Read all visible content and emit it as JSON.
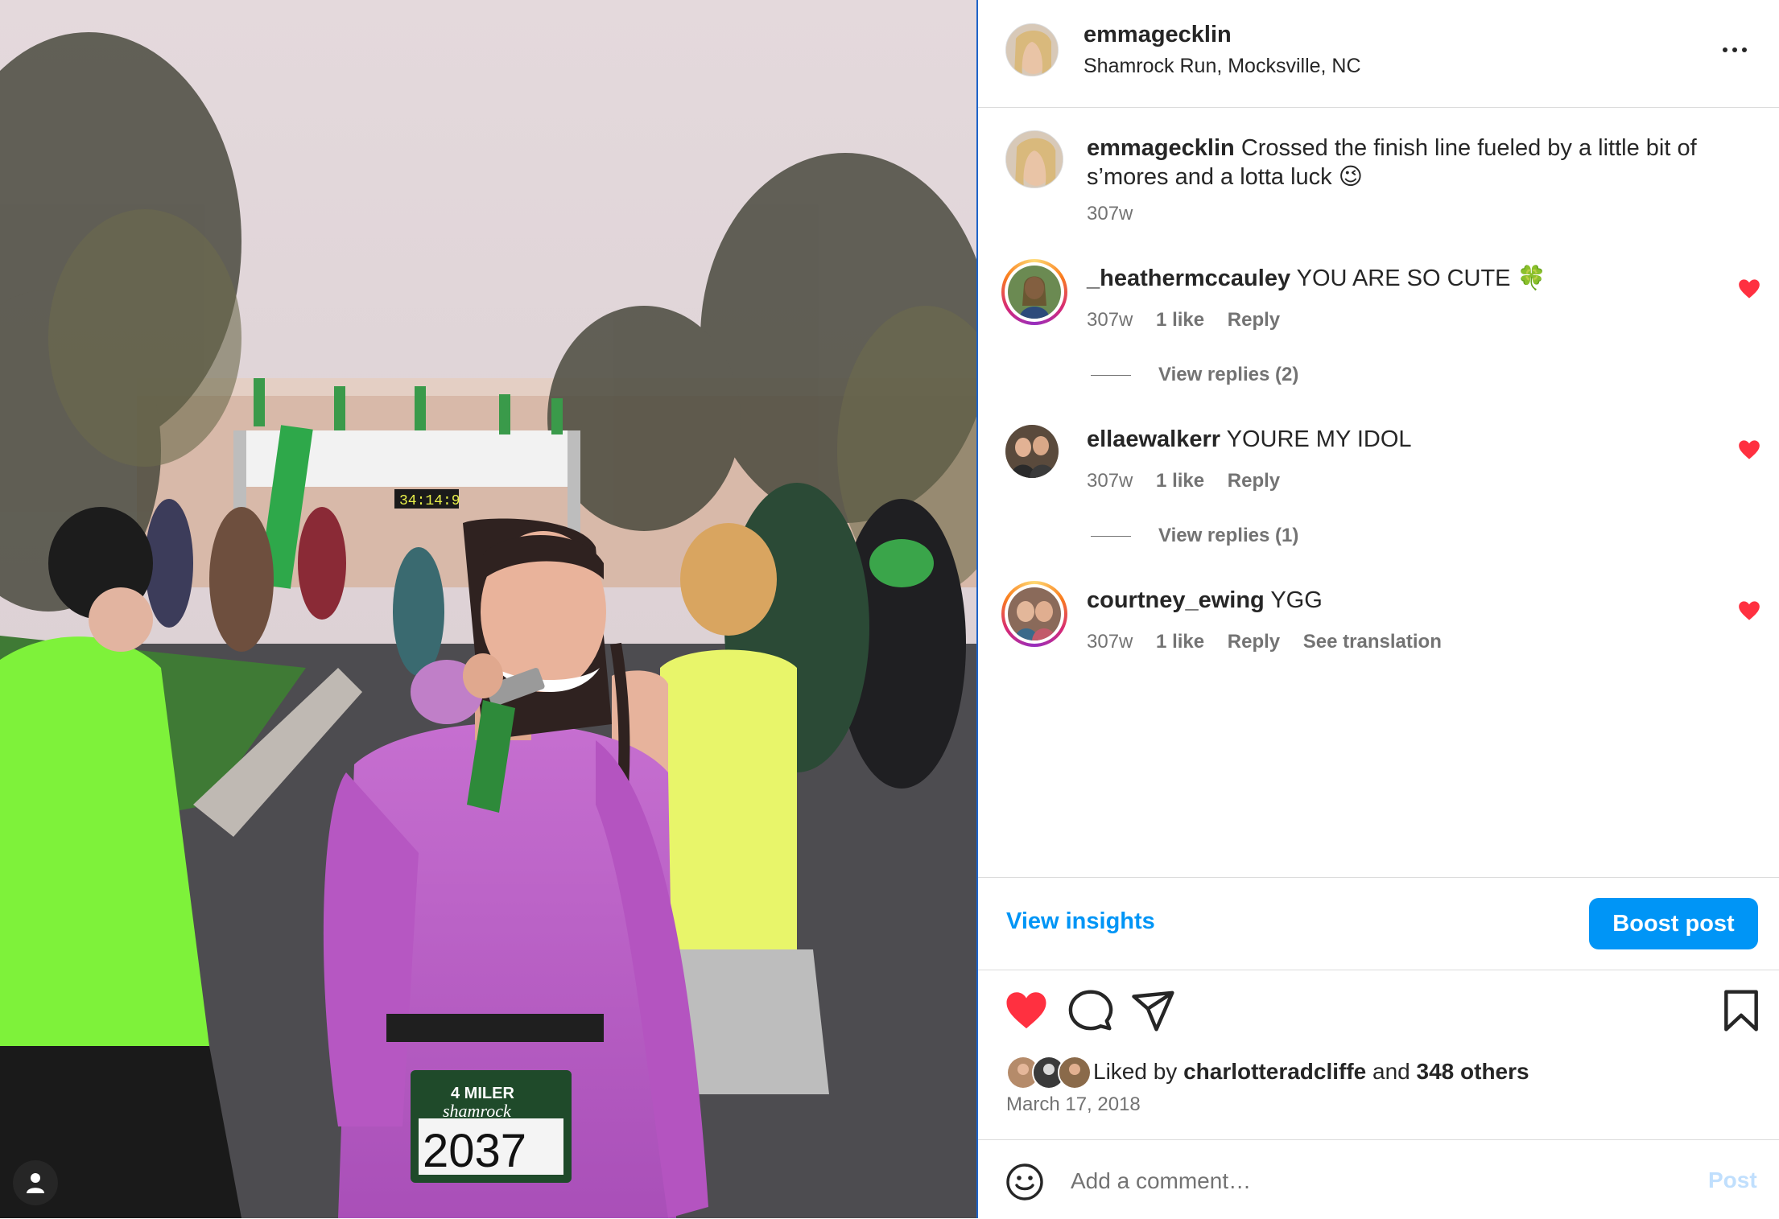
{
  "post": {
    "username": "emmagecklin",
    "location": "Shamrock Run, Mocksville, NC",
    "caption_username": "emmagecklin",
    "caption_text": "Crossed the finish line fueled by a little bit of s’mores and a lotta luck 😉",
    "caption_time": "307w",
    "likes_prefix": "Liked by",
    "likes_user": "charlotteradcliffe",
    "likes_and": "and",
    "likes_others": "348 others",
    "date": "March 17, 2018",
    "liked": true
  },
  "photo": {
    "bib_event": "4 MILER",
    "bib_name": "shamrock",
    "bib_number": "2037",
    "finish_clock": "34:14:9"
  },
  "comments": [
    {
      "username": "_heathermccauley",
      "text": "YOU ARE SO CUTE 🍀",
      "time": "307w",
      "likes": "1 like",
      "reply": "Reply",
      "view_replies": "View replies (2)",
      "liked": true,
      "ring": true
    },
    {
      "username": "ellaewalkerr",
      "text": "YOURE MY IDOL",
      "time": "307w",
      "likes": "1 like",
      "reply": "Reply",
      "view_replies": "View replies (1)",
      "liked": true,
      "ring": false
    },
    {
      "username": "courtney_ewing",
      "text": "YGG",
      "time": "307w",
      "likes": "1 like",
      "reply": "Reply",
      "translation": "See translation",
      "liked": true,
      "ring": true
    }
  ],
  "actions": {
    "view_insights": "View insights",
    "boost_post": "Boost post",
    "comment_placeholder": "Add a comment…",
    "post_label": "Post"
  },
  "icons": {
    "more": "more-horizontal-icon",
    "like": "heart-icon",
    "comment": "comment-icon",
    "share": "send-icon",
    "save": "bookmark-icon",
    "emoji": "emoji-icon",
    "user_tag": "user-icon"
  },
  "colors": {
    "accent": "#0095f6",
    "heart": "#ff3040",
    "muted_text": "#737373",
    "post_disabled": "#c0dffd"
  }
}
